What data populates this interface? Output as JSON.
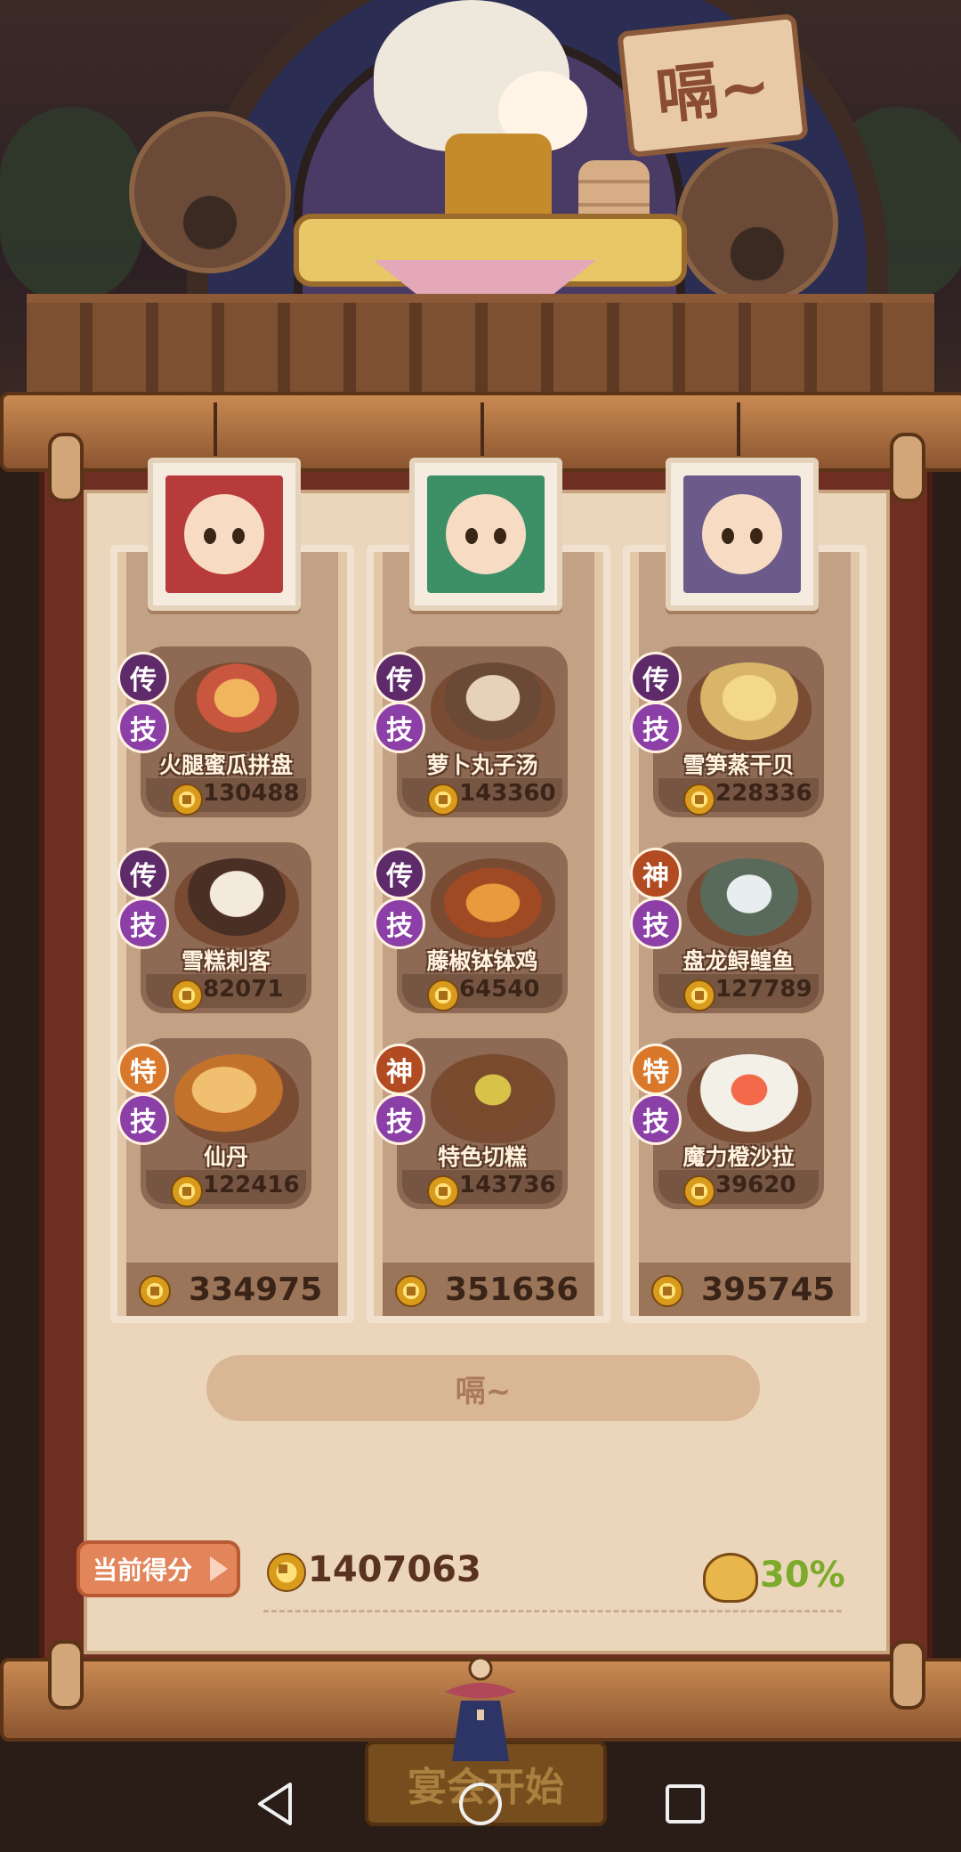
{
  "scene": {
    "sign_text": "嗝~"
  },
  "chefs": [
    {
      "portrait_color": "#b83b3b",
      "dishes": [
        {
          "rarity": "传",
          "skill": "技",
          "name": "火腿蜜瓜拼盘",
          "score": "130488"
        },
        {
          "rarity": "传",
          "skill": "技",
          "name": "雪糕刺客",
          "score": "82071"
        },
        {
          "rarity": "特",
          "skill": "技",
          "name": "仙丹",
          "score": "122416"
        }
      ],
      "total": "334975"
    },
    {
      "portrait_color": "#3d8f66",
      "dishes": [
        {
          "rarity": "传",
          "skill": "技",
          "name": "萝卜丸子汤",
          "score": "143360"
        },
        {
          "rarity": "传",
          "skill": "技",
          "name": "藤椒钵钵鸡",
          "score": "64540"
        },
        {
          "rarity": "神",
          "skill": "技",
          "name": "特色切糕",
          "score": "143736"
        }
      ],
      "total": "351636"
    },
    {
      "portrait_color": "#6b5a8a",
      "dishes": [
        {
          "rarity": "传",
          "skill": "技",
          "name": "雪笋蒸干贝",
          "score": "228336"
        },
        {
          "rarity": "神",
          "skill": "技",
          "name": "盘龙鲟鳇鱼",
          "score": "127789"
        },
        {
          "rarity": "特",
          "skill": "技",
          "name": "魔力橙沙拉",
          "score": "39620"
        }
      ],
      "total": "395745"
    }
  ],
  "action_button_label": "嗝~",
  "score": {
    "tag_label": "当前得分",
    "total": "1407063",
    "bonus_percent": "30%"
  },
  "start_button_label": "宴会开始",
  "colors": {
    "rarity_chuan": "#5e2a6a",
    "rarity_shen": "#b24a22",
    "rarity_te": "#d9782a",
    "skill": "#8d3fa8",
    "bonus_green": "#7caa2a"
  },
  "icons": {
    "coin": "coin-icon",
    "bonus": "lucky-pot-icon",
    "nav": [
      "back-icon",
      "home-icon",
      "recent-apps-icon"
    ]
  }
}
